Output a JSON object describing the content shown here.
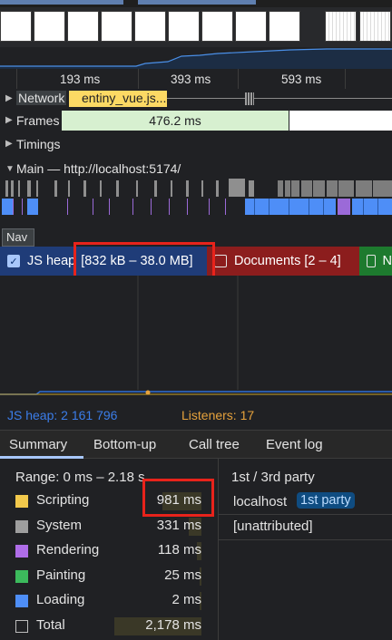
{
  "ruler": {
    "ticks": [
      "193 ms",
      "393 ms",
      "593 ms"
    ]
  },
  "tracks": {
    "network": "Network",
    "network_request": "entiny_vue.js...",
    "frames": "Frames",
    "frame_duration": "476.2 ms",
    "timings": "Timings",
    "main": "Main — http://localhost:5174/"
  },
  "tooltip": {
    "nav": "Nav"
  },
  "counters": {
    "js_heap": {
      "label": "JS heap",
      "range": "[832 kB – 38.0 MB]",
      "checked": true
    },
    "documents": {
      "label": "Documents [2 – 4]",
      "checked": false
    },
    "nodes": {
      "label": "N",
      "checked": false
    }
  },
  "mem_legend": {
    "js_heap": "JS heap: 2 161 796",
    "listeners": "Listeners: 17"
  },
  "bottom_tabs": [
    "Summary",
    "Bottom-up",
    "Call tree",
    "Event log"
  ],
  "summary": {
    "range": "Range: 0 ms – 2.18 s",
    "rows": [
      {
        "name": "Scripting",
        "value": "981 ms",
        "color": "#f2c94c",
        "fraction": 0.45
      },
      {
        "name": "System",
        "value": "331 ms",
        "color": "#9e9e9e",
        "fraction": 0.15
      },
      {
        "name": "Rendering",
        "value": "118 ms",
        "color": "#af6de8",
        "fraction": 0.054
      },
      {
        "name": "Painting",
        "value": "25 ms",
        "color": "#3cba5c",
        "fraction": 0.011
      },
      {
        "name": "Loading",
        "value": "2 ms",
        "color": "#4e8ef7",
        "fraction": 0.001
      },
      {
        "name": "Total",
        "value": "2,178 ms",
        "color": "",
        "fraction": 1.0
      }
    ]
  },
  "party": {
    "title": "1st / 3rd party",
    "rows": [
      {
        "name": "localhost",
        "badge": "1st party"
      },
      {
        "name": "[unattributed]",
        "badge": ""
      }
    ]
  }
}
